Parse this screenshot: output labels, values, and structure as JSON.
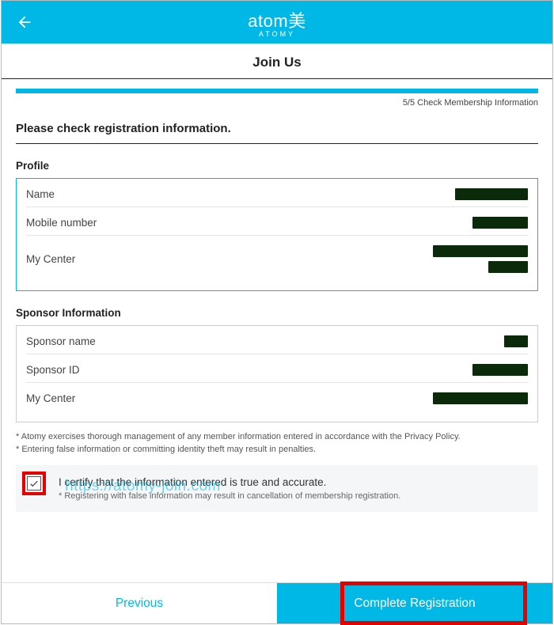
{
  "header": {
    "logo_main": "atom美",
    "logo_sub": "ATOMY"
  },
  "title": "Join Us",
  "step_label": "5/5 Check Membership Information",
  "instruction": "Please check registration information.",
  "profile": {
    "title": "Profile",
    "rows": [
      {
        "label": "Name",
        "redacted_width": 92
      },
      {
        "label": "Mobile number",
        "redacted_width": 70
      },
      {
        "label": "My Center",
        "redacted_stack": [
          120,
          50
        ]
      }
    ]
  },
  "sponsor": {
    "title": "Sponsor Information",
    "rows": [
      {
        "label": "Sponsor name",
        "redacted_width": 30
      },
      {
        "label": "Sponsor ID",
        "redacted_width": 70
      },
      {
        "label": "My Center",
        "redacted_width": 120
      }
    ]
  },
  "fineprint": {
    "line1": "* Atomy exercises thorough management of any member information entered in accordance with the Privacy Policy.",
    "line2": "* Entering false information or committing identity theft may result in penalties."
  },
  "certify": {
    "main": "I certify that the information entered is true and accurate.",
    "sub": "* Registering with false information may result in cancellation of membership registration."
  },
  "watermark": "https://atomy-join.com",
  "buttons": {
    "previous": "Previous",
    "complete": "Complete Registration"
  }
}
